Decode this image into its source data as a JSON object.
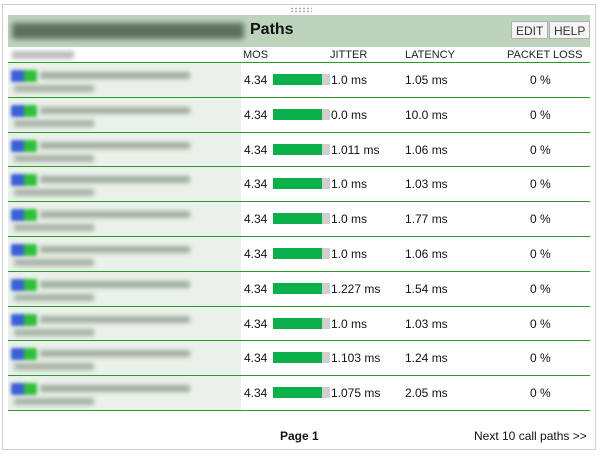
{
  "header": {
    "title": "Paths",
    "edit_label": "EDIT",
    "help_label": "HELP"
  },
  "columns": {
    "mos": "MOS",
    "jitter": "JITTER",
    "latency": "LATENCY",
    "packet_loss": "PACKET LOSS"
  },
  "rows": [
    {
      "mos": "4.34",
      "mos_fill_pct": 86,
      "jitter": "1.0 ms",
      "latency": "1.05 ms",
      "packet_loss": "0 %"
    },
    {
      "mos": "4.34",
      "mos_fill_pct": 86,
      "jitter": "0.0 ms",
      "latency": "10.0 ms",
      "packet_loss": "0 %"
    },
    {
      "mos": "4.34",
      "mos_fill_pct": 86,
      "jitter": "1.011 ms",
      "latency": "1.06 ms",
      "packet_loss": "0 %"
    },
    {
      "mos": "4.34",
      "mos_fill_pct": 86,
      "jitter": "1.0 ms",
      "latency": "1.03 ms",
      "packet_loss": "0 %"
    },
    {
      "mos": "4.34",
      "mos_fill_pct": 86,
      "jitter": "1.0 ms",
      "latency": "1.77 ms",
      "packet_loss": "0 %"
    },
    {
      "mos": "4.34",
      "mos_fill_pct": 86,
      "jitter": "1.0 ms",
      "latency": "1.06 ms",
      "packet_loss": "0 %"
    },
    {
      "mos": "4.34",
      "mos_fill_pct": 86,
      "jitter": "1.227 ms",
      "latency": "1.54 ms",
      "packet_loss": "0 %"
    },
    {
      "mos": "4.34",
      "mos_fill_pct": 86,
      "jitter": "1.0 ms",
      "latency": "1.03 ms",
      "packet_loss": "0 %"
    },
    {
      "mos": "4.34",
      "mos_fill_pct": 86,
      "jitter": "1.103 ms",
      "latency": "1.24 ms",
      "packet_loss": "0 %"
    },
    {
      "mos": "4.34",
      "mos_fill_pct": 86,
      "jitter": "1.075 ms",
      "latency": "2.05 ms",
      "packet_loss": "0 %"
    }
  ],
  "footer": {
    "page_label": "Page 1",
    "next_label": "Next 10 call paths >>"
  },
  "colors": {
    "bar_fill": "#0bb04b",
    "row_divider": "#2b9a2b",
    "header_bg": "#bcd3bc"
  },
  "icons": [
    "drag-grip-icon",
    "call-path-icon"
  ]
}
